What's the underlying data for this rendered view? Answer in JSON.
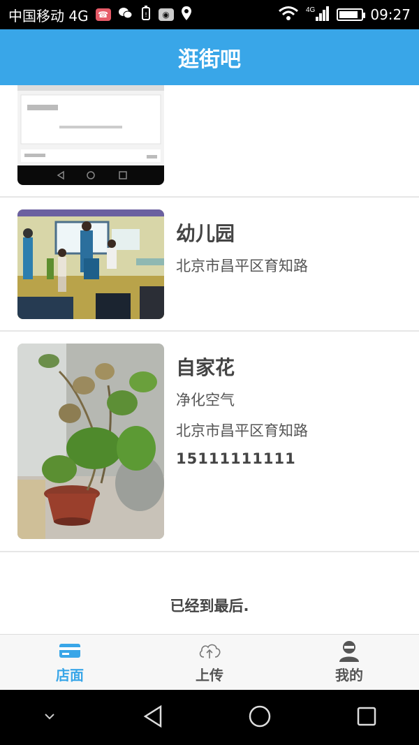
{
  "status_bar": {
    "carrier": "中国移动 4G",
    "network": "4G",
    "time": "09:27",
    "icons": [
      "missed-call-icon",
      "wechat-icon",
      "battery-alert-icon",
      "app-icon",
      "location-icon",
      "wifi-icon",
      "signal-icon",
      "battery-icon"
    ]
  },
  "header": {
    "title": "逛街吧"
  },
  "cards": [
    {
      "title": "",
      "lines": [],
      "phone": "",
      "image": "phone-screenshot-image"
    },
    {
      "title": "幼儿园",
      "lines": [
        "北京市昌平区育知路"
      ],
      "phone": "",
      "image": "kindergarten-photo"
    },
    {
      "title": "自家花",
      "lines": [
        "净化空气",
        "北京市昌平区育知路"
      ],
      "phone": "15111111111",
      "image": "plant-photo"
    }
  ],
  "footer": {
    "end_text": "已经到最后."
  },
  "bottom_nav": {
    "items": [
      {
        "label": "店面",
        "icon": "card-icon",
        "active": true
      },
      {
        "label": "上传",
        "icon": "cloud-upload-icon",
        "active": false
      },
      {
        "label": "我的",
        "icon": "profile-icon",
        "active": false
      }
    ]
  },
  "colors": {
    "accent": "#39a6e8",
    "text": "#444444",
    "divider": "#e6e6e6"
  }
}
